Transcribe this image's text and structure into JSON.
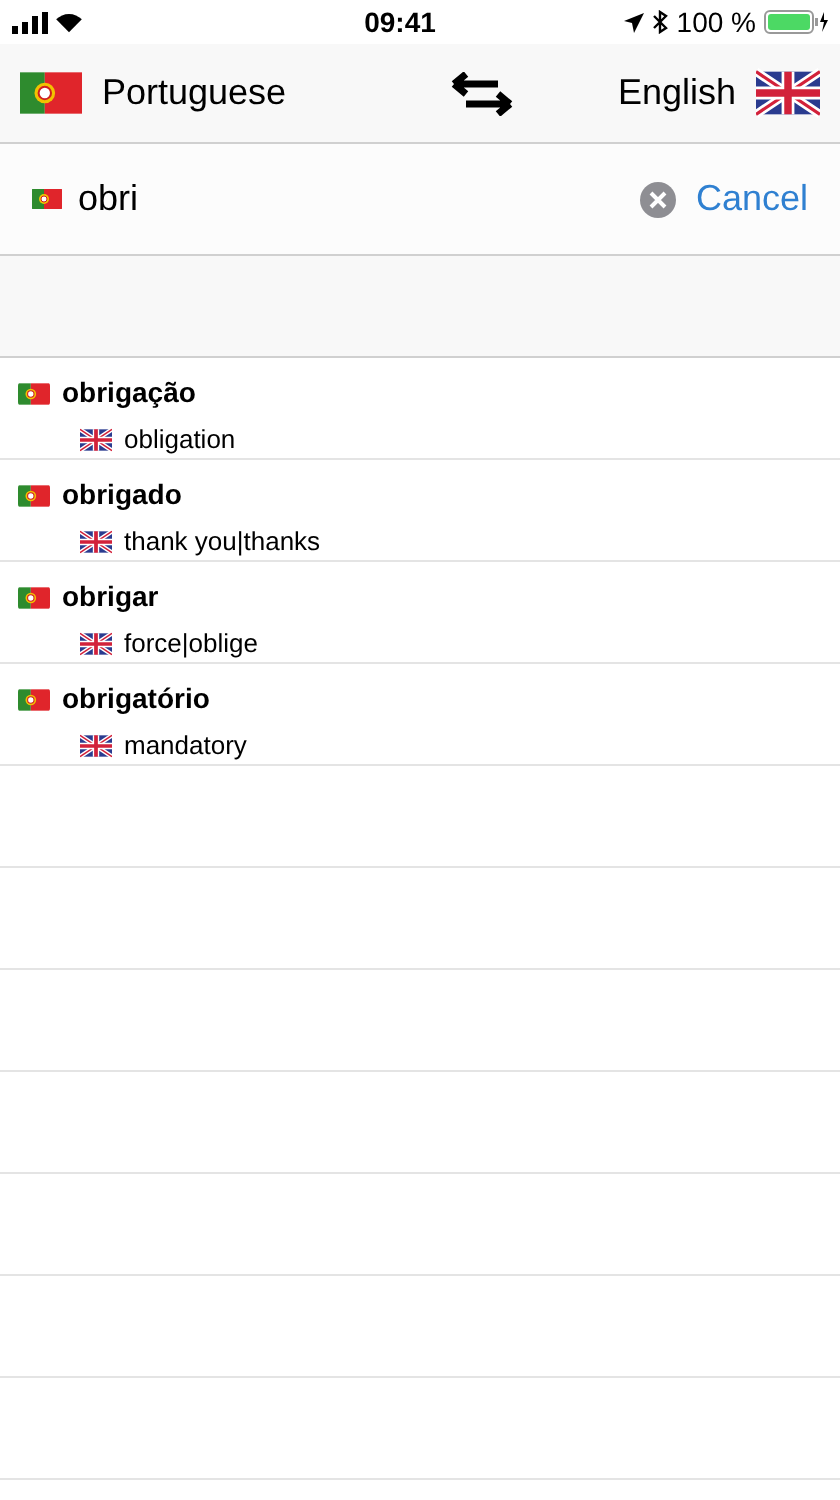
{
  "status_bar": {
    "time": "09:41",
    "battery": "100 %"
  },
  "header": {
    "source_language": "Portuguese",
    "target_language": "English"
  },
  "search": {
    "value": "obri",
    "cancel": "Cancel"
  },
  "results": [
    {
      "word": "obrigação",
      "translation": "obligation"
    },
    {
      "word": "obrigado",
      "translation": "thank you|thanks"
    },
    {
      "word": "obrigar",
      "translation": "force|oblige"
    },
    {
      "word": "obrigatório",
      "translation": "mandatory"
    }
  ]
}
